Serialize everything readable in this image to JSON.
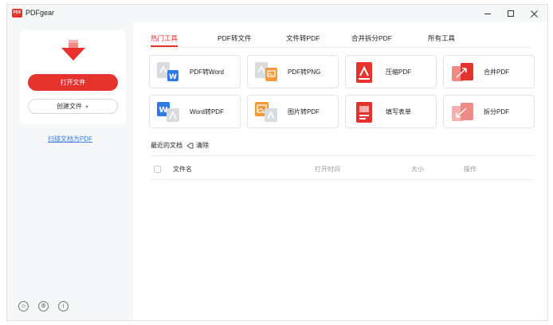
{
  "app": {
    "title": "PDFgear",
    "logo_text": "PDF"
  },
  "sidebar": {
    "open_file": "打开文件",
    "create_file": "创建文件",
    "scan_link": "扫描文档为PDF",
    "accent": "#e5322d"
  },
  "tabs": [
    {
      "label": "热门工具",
      "active": true
    },
    {
      "label": "PDF转文件",
      "active": false
    },
    {
      "label": "文件转PDF",
      "active": false
    },
    {
      "label": "合并拆分PDF",
      "active": false
    },
    {
      "label": "所有工具",
      "active": false
    }
  ],
  "tools": [
    {
      "label": "PDF转Word",
      "icon": "pdf-to-word-icon"
    },
    {
      "label": "PDF转PNG",
      "icon": "pdf-to-png-icon"
    },
    {
      "label": "压缩PDF",
      "icon": "compress-pdf-icon"
    },
    {
      "label": "合并PDF",
      "icon": "merge-pdf-icon"
    },
    {
      "label": "Word转PDF",
      "icon": "word-to-pdf-icon"
    },
    {
      "label": "图片转PDF",
      "icon": "image-to-pdf-icon"
    },
    {
      "label": "填写表单",
      "icon": "fill-form-icon"
    },
    {
      "label": "拆分PDF",
      "icon": "split-pdf-icon"
    }
  ],
  "recent": {
    "title": "最近的文档",
    "clear": "清除",
    "columns": {
      "name": "文件名",
      "opened": "打开时间",
      "size": "大小",
      "actions": "操作"
    }
  }
}
